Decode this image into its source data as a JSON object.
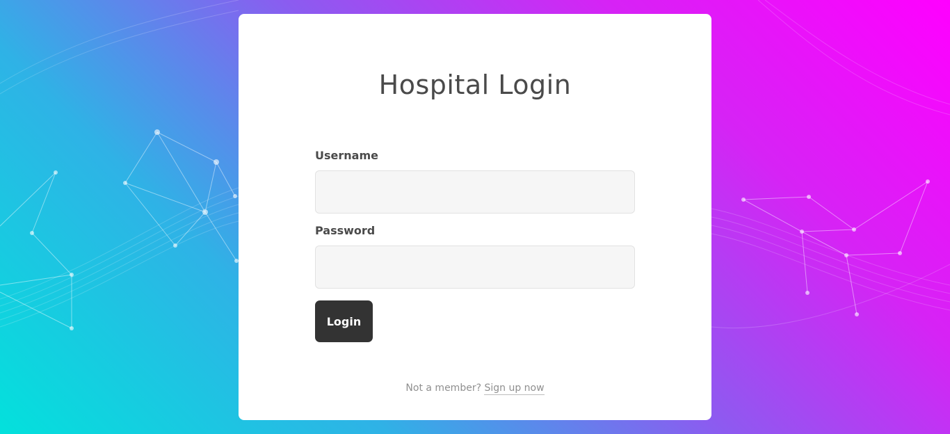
{
  "page": {
    "title": "Hospital Login"
  },
  "form": {
    "username_label": "Username",
    "username_value": "",
    "password_label": "Password",
    "password_value": "",
    "login_button": "Login"
  },
  "footer": {
    "prompt": "Not a member?",
    "signup_link": "Sign up now"
  },
  "colors": {
    "gradient_start": "#03e1dc",
    "gradient_end": "#ff00ff",
    "button_bg": "#333333",
    "card_bg": "#ffffff"
  }
}
